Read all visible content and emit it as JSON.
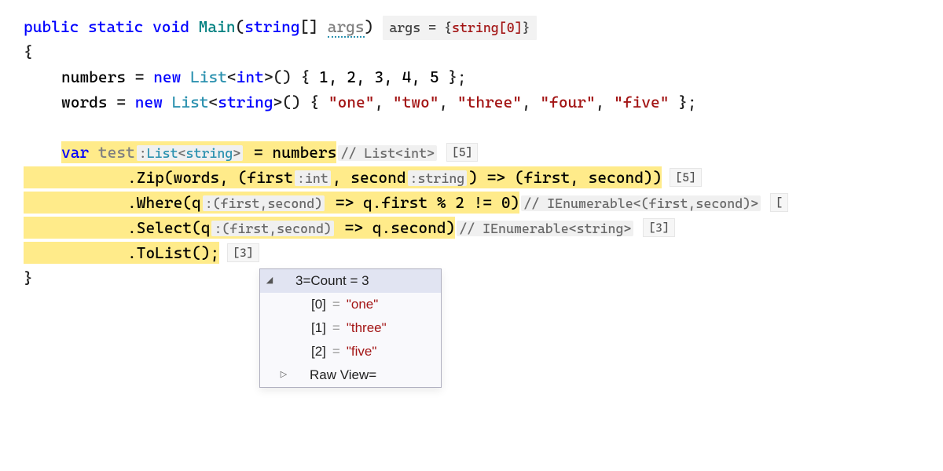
{
  "signature": {
    "public": "public",
    "static": "static",
    "void": "void",
    "main": "Main",
    "string": "string",
    "args": "args",
    "args_tip_pre": "args = {",
    "args_tip_type": "string[0]",
    "args_tip_post": "}"
  },
  "braces": {
    "open": "{",
    "close": "}"
  },
  "numbers_line": {
    "var": "numbers",
    "eq": " = ",
    "new": "new",
    "List": "List",
    "int": "int",
    "open": "() { ",
    "vals": "1, 2, 3, 4, 5",
    "close": " };"
  },
  "words_line": {
    "var": "words",
    "eq": " = ",
    "new": "new",
    "List": "List",
    "string": "string",
    "open": "() { ",
    "strings": [
      "\"one\"",
      "\"two\"",
      "\"three\"",
      "\"four\"",
      "\"five\""
    ],
    "close": " };"
  },
  "chain": {
    "var": "var",
    "test": "test",
    "hint_test": ":List<string>",
    "eq": " = ",
    "numbers": "numbers",
    "cmt_numbers": "// List<int>",
    "cnt_numbers": "[5]",
    "zip_pre": ".Zip(words, (first",
    "zip_hint1": ":int",
    "zip_mid": ", second",
    "zip_hint2": ":string",
    "zip_post": ") => (first, second))",
    "cnt_zip": "[5]",
    "where_pre": ".Where(q",
    "where_hint": ":(first,second)",
    "where_post": " => q.first % 2 != 0)",
    "cmt_where": "// IEnumerable<(first,second)>",
    "cnt_where": "[",
    "select_pre": ".Select(q",
    "select_hint": ":(first,second)",
    "select_post": " => q.second)",
    "cmt_select": "// IEnumerable<string>",
    "cnt_select": "[3]",
    "tolist": ".ToList();",
    "cnt_tolist": "[3]"
  },
  "popup": {
    "header_tri": "◢",
    "header_text": "3=Count = 3",
    "rows": [
      {
        "key": "[0]",
        "val": "\"one\""
      },
      {
        "key": "[1]",
        "val": "\"three\""
      },
      {
        "key": "[2]",
        "val": "\"five\""
      }
    ],
    "raw_tri": "▷",
    "raw": "Raw View="
  }
}
